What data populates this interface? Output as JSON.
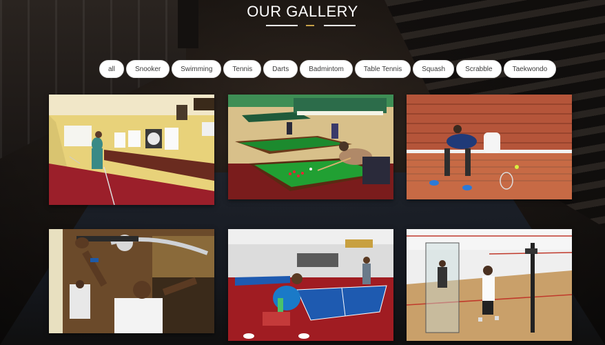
{
  "header": {
    "title": "OUR GALLERY"
  },
  "filters": [
    {
      "label": "all"
    },
    {
      "label": "Snooker"
    },
    {
      "label": "Swimming"
    },
    {
      "label": "Tennis"
    },
    {
      "label": "Darts"
    },
    {
      "label": "Badmintom"
    },
    {
      "label": "Table Tennis"
    },
    {
      "label": "Squash"
    },
    {
      "label": "Scrabble"
    },
    {
      "label": "Taekwondo"
    }
  ],
  "colors": {
    "accent_rule": "#c8a24a",
    "button_bg": "#ffffff",
    "title_text": "#ffffff"
  },
  "gallery": [
    {
      "subject": "darts-room-photo"
    },
    {
      "subject": "snooker-table-photo"
    },
    {
      "subject": "tennis-court-photo"
    },
    {
      "subject": "gym-machine-photo"
    },
    {
      "subject": "table-tennis-photo"
    },
    {
      "subject": "squash-court-photo"
    }
  ]
}
